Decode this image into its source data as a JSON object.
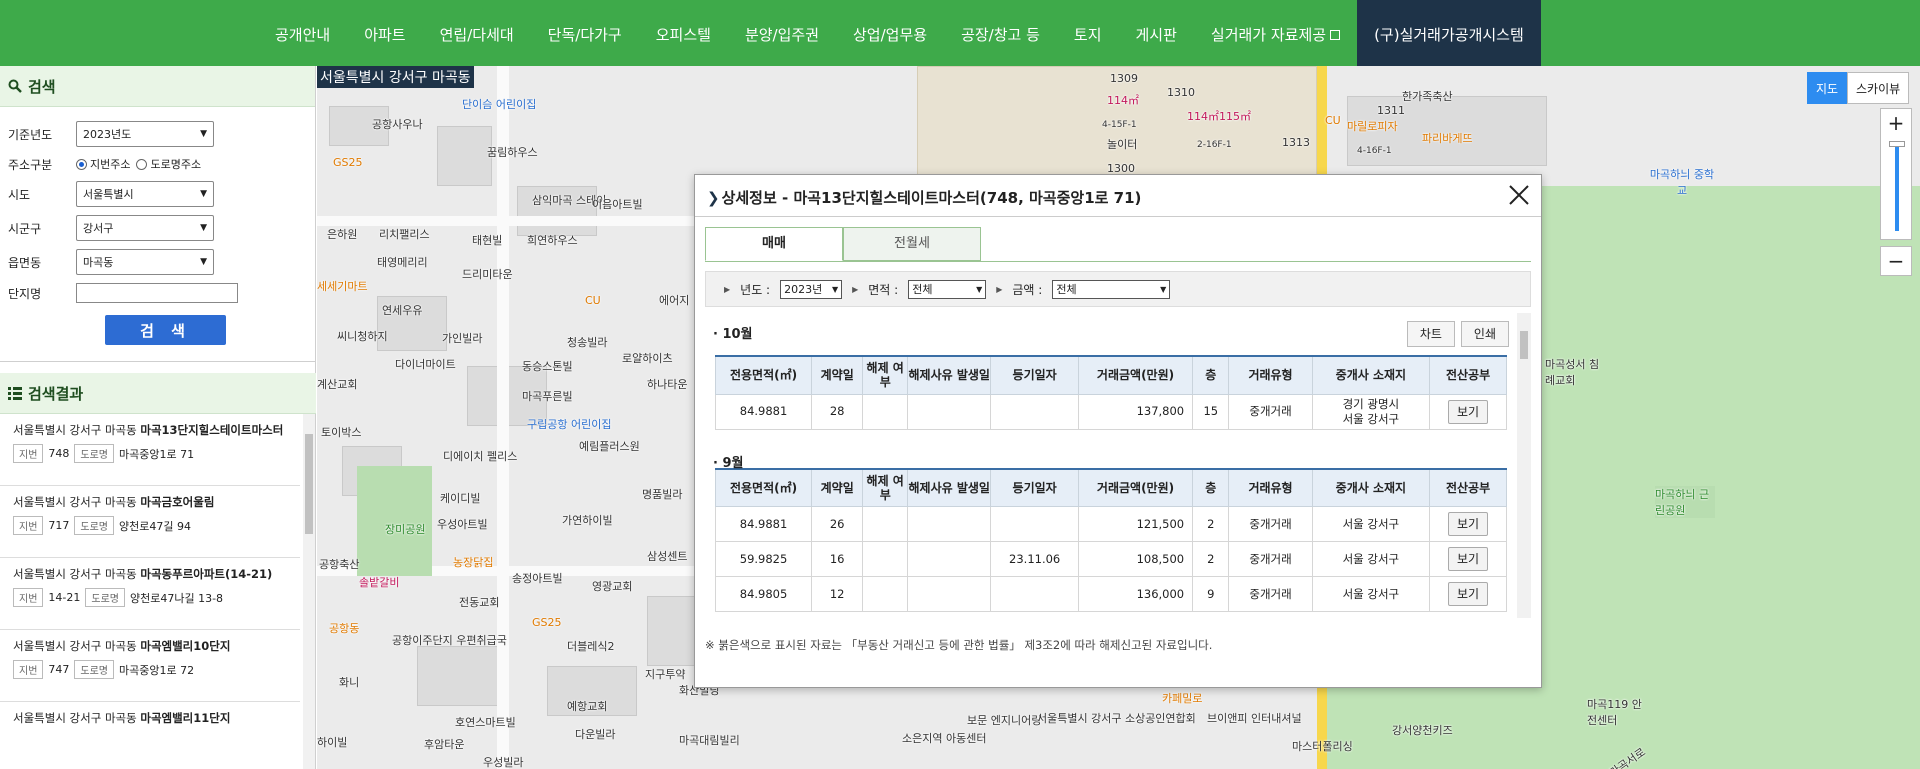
{
  "nav": {
    "items": [
      "공개안내",
      "아파트",
      "연립/다세대",
      "단독/다가구",
      "오피스텔",
      "분양/입주권",
      "상업/업무용",
      "공장/창고 등",
      "토지",
      "게시판",
      "실거래가 자료제공"
    ],
    "legacy": "(구)실거래가공개시스템"
  },
  "search": {
    "title": "검색",
    "year_label": "기준년도",
    "year_value": "2023년도",
    "addr_type_label": "주소구분",
    "addr_jibun": "지번주소",
    "addr_road": "도로명주소",
    "sido_label": "시도",
    "sido_value": "서울특별시",
    "sigungu_label": "시군구",
    "sigungu_value": "강서구",
    "dong_label": "읍면동",
    "dong_value": "마곡동",
    "complex_label": "단지명",
    "complex_value": "",
    "button": "검 색"
  },
  "results": {
    "title": "검색결과",
    "jibun_tag": "지번",
    "road_tag": "도로명",
    "items": [
      {
        "prefix": "서울특별시 강서구 마곡동 ",
        "name": "마곡13단지힐스테이트마스터",
        "jibun": "748",
        "road": "마곡중앙1로 71"
      },
      {
        "prefix": "서울특별시 강서구 마곡동 ",
        "name": "마곡금호어울림",
        "jibun": "717",
        "road": "양천로47길 94"
      },
      {
        "prefix": "서울특별시 강서구 마곡동 ",
        "name": "마곡동푸르아파트(14-21)",
        "jibun": "14-21",
        "road": "양천로47나길 13-8"
      },
      {
        "prefix": "서울특별시 강서구 마곡동 ",
        "name": "마곡엠밸리10단지",
        "jibun": "747",
        "road": "마곡중앙1로 72"
      },
      {
        "prefix": "서울특별시 강서구 마곡동 ",
        "name": "마곡엠밸리11단지",
        "jibun": "",
        "road": ""
      }
    ]
  },
  "map": {
    "address": "서울특별시 강서구 마곡동",
    "btn_map": "지도",
    "btn_sky": "스카이뷰",
    "zoom_in": "+",
    "zoom_out": "−",
    "labels": {
      "gongsang": "공항사우나",
      "danisum": "단이슴 어린이집",
      "kkum": "꿈림하우스",
      "samik": "삼익마곡 스테이",
      "iumart": "이음아트빌",
      "gs25a": "GS25",
      "eunha": "은하원",
      "richi": "리치팰리스",
      "taehyun": "태현빌",
      "heeyeon": "희연하우스",
      "taeyoung": "태영메리리",
      "drimi": "드리미타운",
      "sesegi": "세세기마트",
      "yeonsae": "연세우유",
      "cu1": "CU",
      "eye": "에어지",
      "ssiniteu": "씨니청하지",
      "ga": "가인빌라",
      "chungsong": "청송빌라",
      "royal": "로얄하이츠",
      "dainer": "다이너마이트",
      "dongsu": "동승스톤빌",
      "gyesan": "계산교회",
      "maku": "마곡푸른빌",
      "hana": "하나타운",
      "toi": "토이박스",
      "guri": "구립공항 어린이집",
      "yerim": "예림플러스원",
      "dieach": "디에이치 펠리스",
      "kaedi": "케이디빌",
      "myeongpum": "명품빌라",
      "jangmi": "장미공원",
      "woosung": "우성아트빌",
      "gayeon": "가연하이빌",
      "gonghang": "공항축산",
      "nongjang": "농장닭집",
      "songjeong": "송정아트빌",
      "samsung": "삼성센트",
      "solbat": "솔밭갈비",
      "jeondong": "전동교회",
      "youngkwang": "영광교회",
      "gs25b": "GS25",
      "gonghangdong": "공항동",
      "uche": "공항이주단지 우편취급국",
      "deobul": "더블레식2",
      "hwani": "화니",
      "jigu": "지구투약",
      "hwasan": "화산빌딩",
      "hoyeon": "호연스마트빌",
      "yehang": "예항교회",
      "daun": "다운빌라",
      "macok_daerim": "마곡대림빌리",
      "soeun": "소은지역 아동센터",
      "bobo": "보문 엔지니어링",
      "smallbiz": "서울특별시 강서구 소상공인연합회",
      "cafe": "카페밀로",
      "brand": "브이앤피 인터내셔널",
      "master": "마스터폴리싱",
      "gangseo_kids": "강서양천키즈",
      "hoyeon2": "후암타운",
      "woosung2": "우성빌라",
      "hanibil": "하이빌",
      "b1309": "1309",
      "b1310": "1310",
      "a114": "114㎡",
      "a114b": "114㎡115㎡",
      "hangaram": "한가족축산",
      "cu2": "CU",
      "marble": "마릴로피자",
      "paris": "파리바게뜨",
      "b1311": "1311",
      "b1313": "1313",
      "b1300": "1300",
      "noli": "놀이터",
      "f4": "4-15F-1",
      "f2": "2-16F-1",
      "f4b": "4-16F-1",
      "school": "마곡하늬 중학교",
      "church": "마곡성서 침례교회",
      "park": "마곡하늬 근린공원",
      "center": "마곡119 안전센터",
      "road": "마곡서로"
    }
  },
  "modal": {
    "title": "상세정보 - 마곡13단지힐스테이트마스터(748, 마곡중앙1로 71)",
    "tab_sale": "매매",
    "tab_rent": "전월세",
    "year_label": "년도 :",
    "year_value": "2023년",
    "area_label": "면적 :",
    "area_value": "전체",
    "price_label": "금액 :",
    "price_value": "전체",
    "btn_chart": "차트",
    "btn_print": "인쇄",
    "headers": [
      "전용면적(㎡)",
      "계약일",
      "해제 여부",
      "해제사유 발생일",
      "등기일자",
      "거래금액(만원)",
      "층",
      "거래유형",
      "중개사 소재지",
      "전산공부"
    ],
    "view_btn": "보기",
    "months": [
      {
        "label": "· 10월",
        "rows": [
          {
            "area": "84.9881",
            "day": "28",
            "cancel": "",
            "cancel_date": "",
            "reg_date": "",
            "price": "137,800",
            "floor": "15",
            "type": "중개거래",
            "agent": "경기 광명시\n서울 강서구"
          }
        ]
      },
      {
        "label": "· 9월",
        "rows": [
          {
            "area": "84.9881",
            "day": "26",
            "cancel": "",
            "cancel_date": "",
            "reg_date": "",
            "price": "121,500",
            "floor": "2",
            "type": "중개거래",
            "agent": "서울 강서구"
          },
          {
            "area": "59.9825",
            "day": "16",
            "cancel": "",
            "cancel_date": "",
            "reg_date": "23.11.06",
            "price": "108,500",
            "floor": "2",
            "type": "중개거래",
            "agent": "서울 강서구"
          },
          {
            "area": "84.9805",
            "day": "12",
            "cancel": "",
            "cancel_date": "",
            "reg_date": "",
            "price": "136,000",
            "floor": "9",
            "type": "중개거래",
            "agent": "서울 강서구"
          }
        ]
      }
    ],
    "note": "※ 붉은색으로 표시된 자료는 「부동산 거래신고 등에 관한 법률」 제3조2에 따라 해제신고된 자료입니다."
  }
}
